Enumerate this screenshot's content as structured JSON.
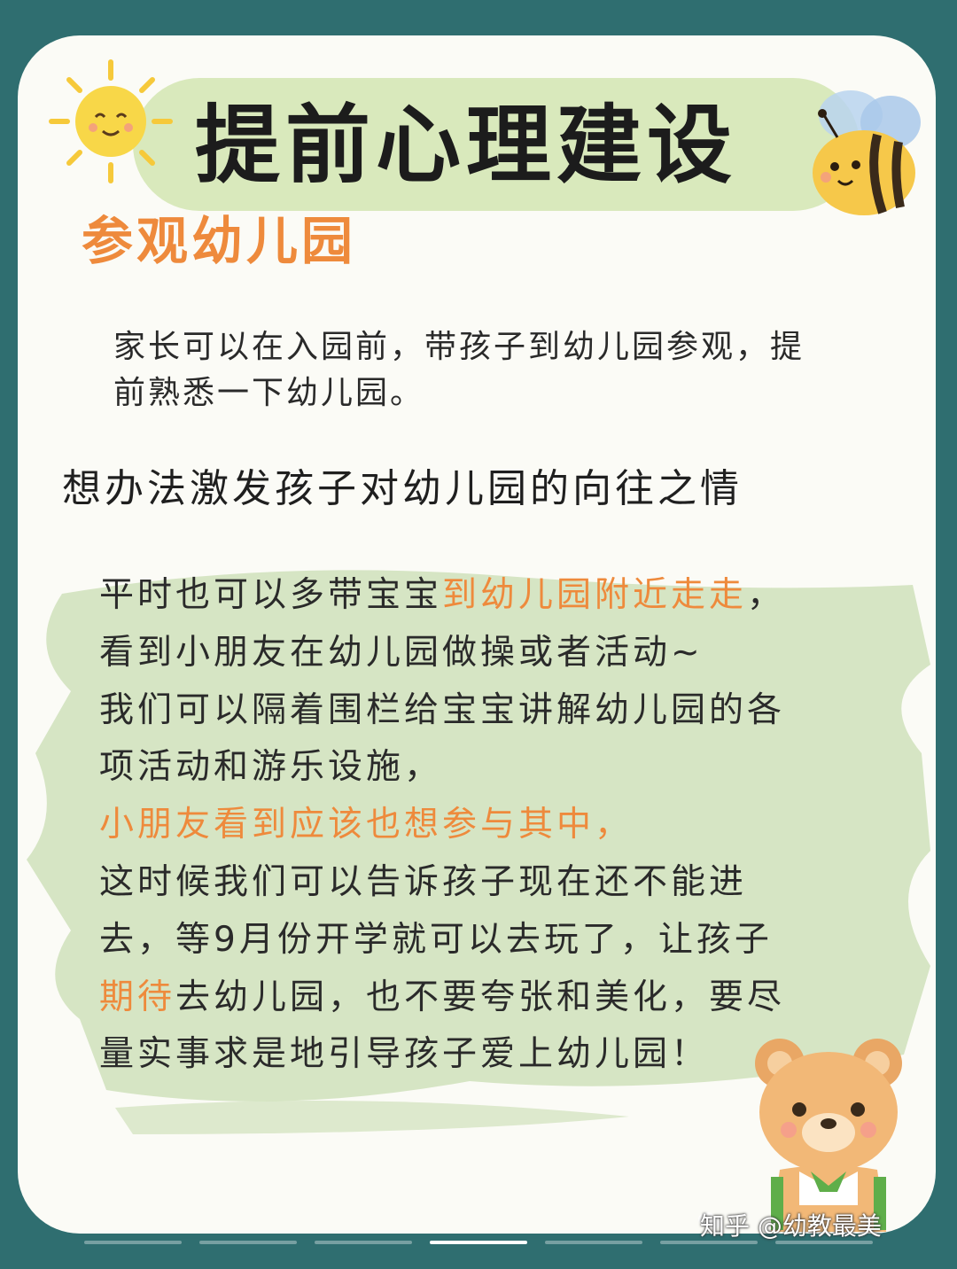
{
  "title": "提前心理建设",
  "subtitle": "参观幼儿园",
  "paragraph1": "家长可以在入园前，带孩子到幼儿园参观，提前熟悉一下幼儿园。",
  "heading2": "想办法激发孩子对幼儿园的向往之情",
  "paragraph2": {
    "line1_a": "平时也可以多带宝宝",
    "line1_b": "到幼儿园附近走走",
    "line1_c": "，",
    "line2": "看到小朋友在幼儿园做操或者活动~",
    "line3": "我们可以隔着围栏给宝宝讲解幼儿园的各",
    "line4": "项活动和游乐设施，",
    "line5": "小朋友看到应该也想参与其中，",
    "line6": "这时候我们可以告诉孩子现在还不能进",
    "line7": "去，等9月份开学就可以去玩了，让孩子",
    "line8_a": "期待",
    "line8_b": "去幼儿园，也不要夸张和美化，要尽",
    "line9": "量实事求是地引导孩子爱上幼儿园！"
  },
  "watermark": "知乎 @幼教最美",
  "colors": {
    "background": "#2f6e70",
    "card": "#fbfbf6",
    "accent_orange": "#ee8a3c",
    "title_band": "#d9e9bc",
    "brush_green": "#c9deb3"
  },
  "icons": [
    "sun-icon",
    "bee-icon",
    "bear-icon",
    "wechat-icon"
  ]
}
